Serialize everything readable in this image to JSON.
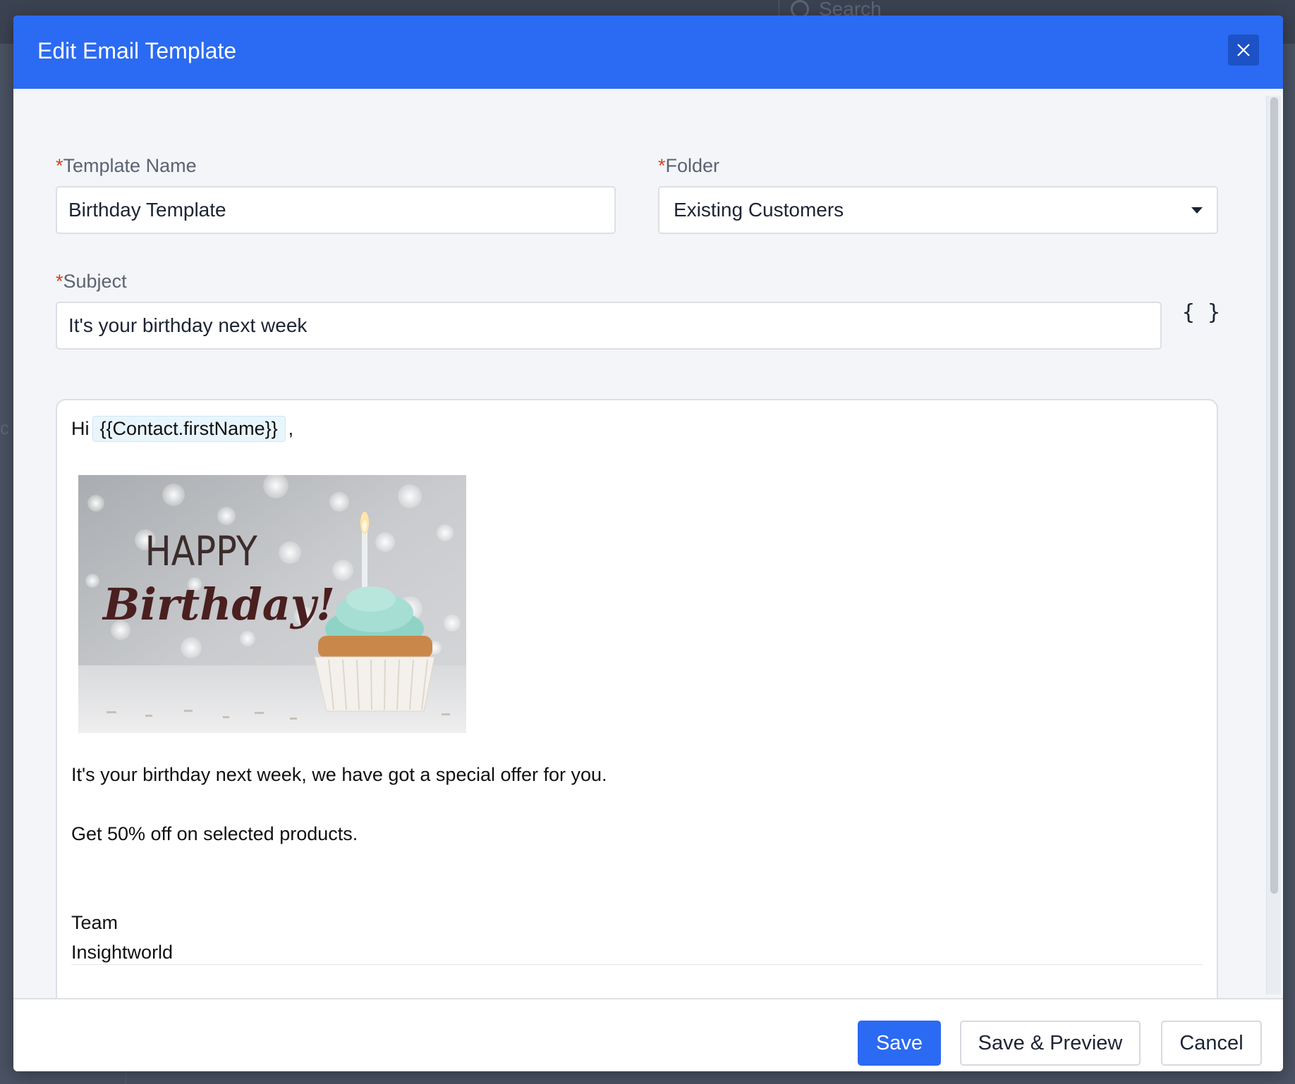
{
  "background": {
    "search_placeholder": "Search"
  },
  "modal": {
    "title": "Edit Email Template",
    "close_icon": "close-icon"
  },
  "form": {
    "template_name": {
      "label": "Template Name",
      "required_mark": "*",
      "value": "Birthday Template"
    },
    "folder": {
      "label": "Folder",
      "required_mark": "*",
      "value": "Existing Customers"
    },
    "subject": {
      "label": "Subject",
      "required_mark": "*",
      "value": "It's your birthday next week"
    },
    "merge_fields_button": "{ }"
  },
  "editor": {
    "greeting_prefix": "Hi",
    "merge_tag": "{{Contact.firstName}}",
    "greeting_suffix": ",",
    "image": {
      "line1": "HAPPY",
      "line2": "Birthday!"
    },
    "paragraph1": "It's your birthday next week, we have got a special offer for you.",
    "paragraph2": "Get 50% off on selected products.",
    "signoff_line1": "Team",
    "signoff_line2": "Insightworld"
  },
  "footer": {
    "save_label": "Save",
    "save_preview_label": "Save & Preview",
    "cancel_label": "Cancel"
  },
  "colors": {
    "header_blue": "#2b6af2",
    "required_red": "#d3411f"
  }
}
